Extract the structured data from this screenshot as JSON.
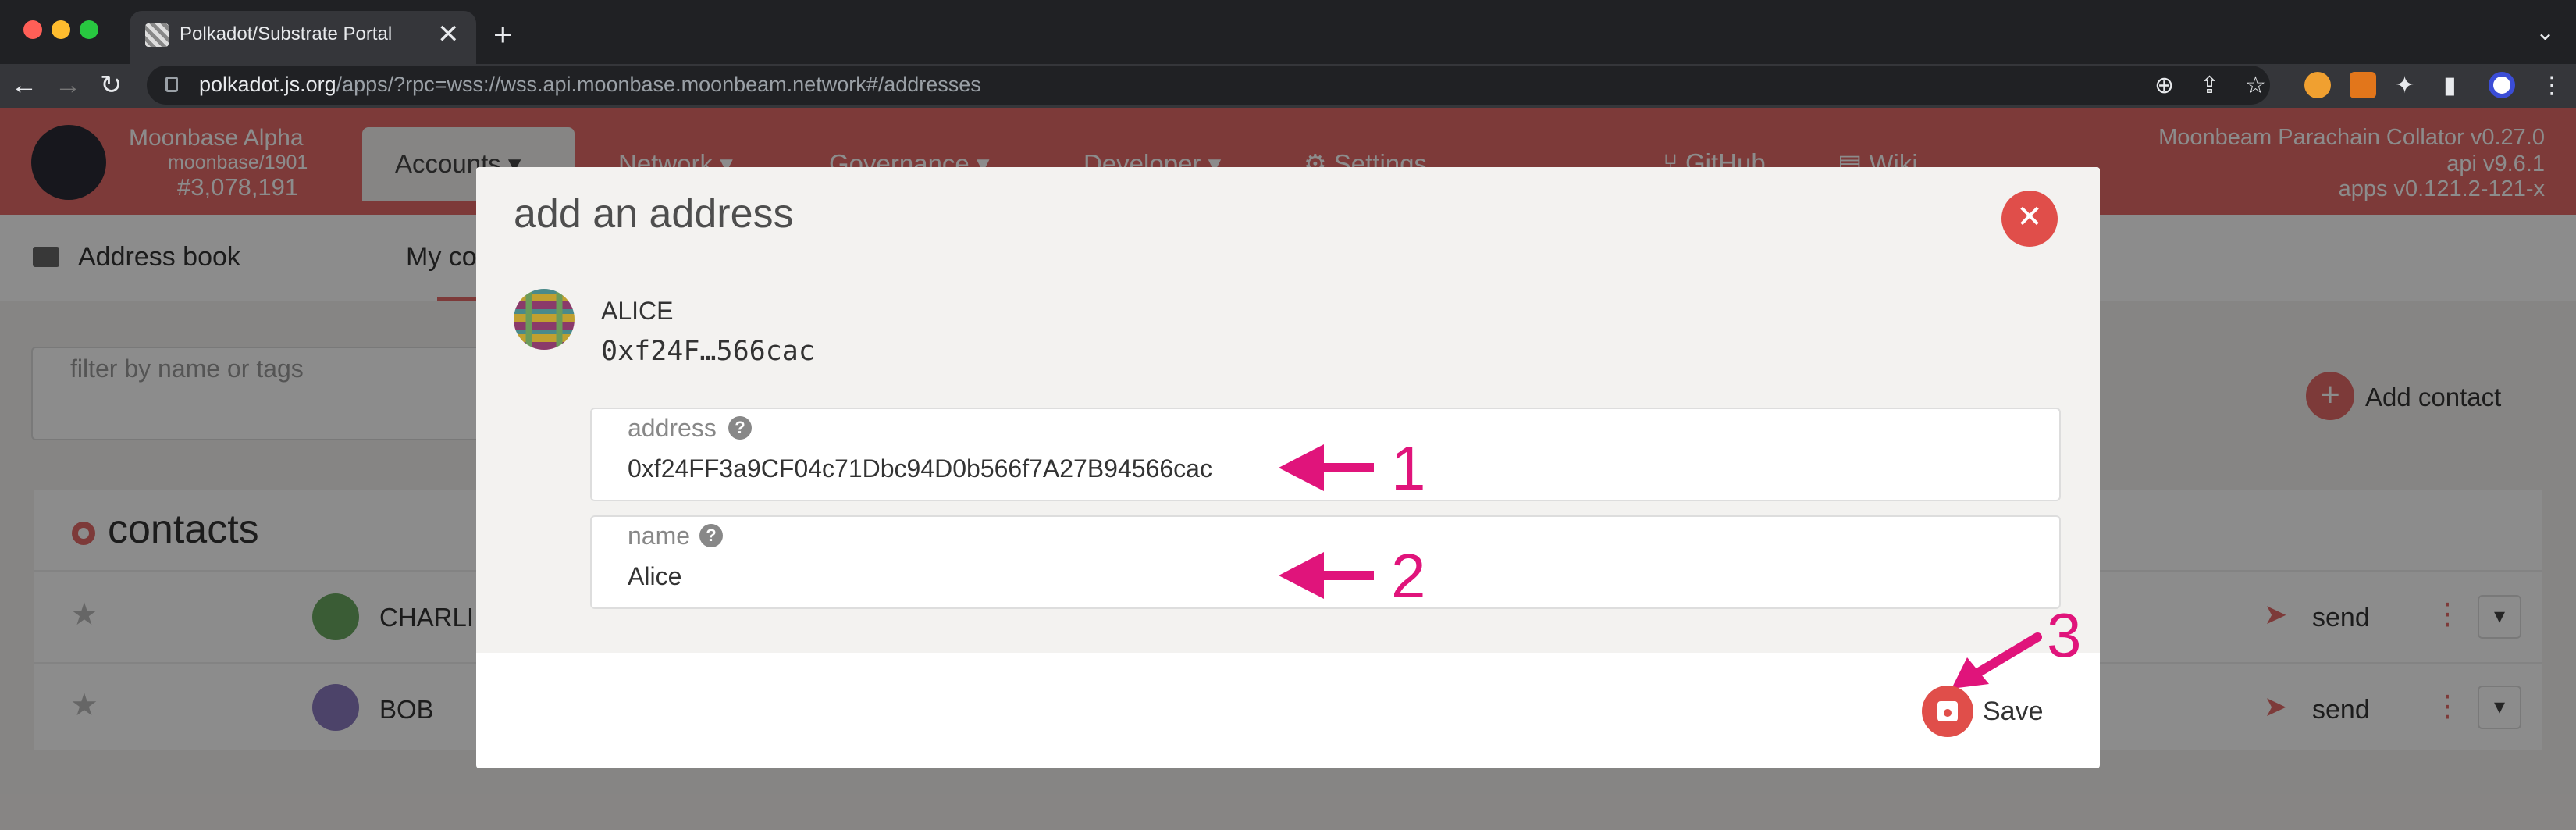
{
  "browser": {
    "tab_title": "Polkadot/Substrate Portal",
    "tab_close": "✕",
    "new_tab": "+",
    "tab_list": "⌄",
    "url_host": "polkadot.js.org",
    "url_rest": "/apps/?rpc=wss://wss.api.moonbase.moonbeam.network#/addresses",
    "back": "←",
    "forward": "→",
    "reload": "↻"
  },
  "header": {
    "chain_name": "Moonbase Alpha",
    "chain_runtime": "moonbase/1901",
    "chain_block": "#3,078,191",
    "nav_active": "Accounts ▾",
    "nav": [
      "Network ▾",
      "Governance ▾",
      "Developer ▾",
      "⚙ Settings",
      "⑂ GitHub",
      "▤ Wiki"
    ],
    "versions": [
      "Moonbeam Parachain Collator v0.27.0",
      "api v9.6.1",
      "apps v0.121.2-121-x"
    ]
  },
  "subnav": {
    "address_book": "Address book",
    "my_contacts": "My co"
  },
  "filter_placeholder": "filter by name or tags",
  "add_contact": "Add contact",
  "contacts": {
    "title": "contacts",
    "rows": [
      {
        "name": "CHARLI",
        "send": "send"
      },
      {
        "name": "BOB",
        "send": "send"
      }
    ]
  },
  "modal": {
    "title": "add an address",
    "close": "✕",
    "account_name": "ALICE",
    "account_short": "0xf24F…566cac",
    "address_label": "address",
    "address_value": "0xf24FF3a9CF04c71Dbc94D0b566f7A27B94566cac",
    "name_label": "name",
    "name_value": "Alice",
    "save": "Save",
    "help": "?"
  },
  "annotations": [
    "1",
    "2",
    "3"
  ],
  "colors": {
    "brand": "#e46b68",
    "annotation": "#e0147b",
    "close_button": "#e04e4a"
  }
}
